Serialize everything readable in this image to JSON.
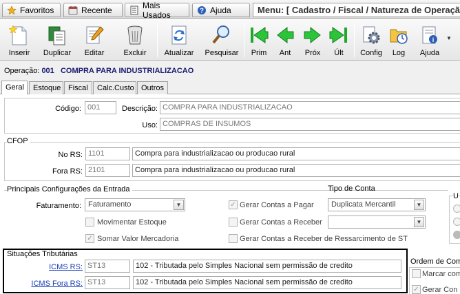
{
  "topbar": {
    "tabs": [
      {
        "label": "Favoritos",
        "icon": "star-icon"
      },
      {
        "label": "Recente",
        "icon": "clock-icon"
      },
      {
        "label": "Mais Usados",
        "icon": "document-icon"
      },
      {
        "label": "Ajuda",
        "icon": "help-icon"
      }
    ],
    "menu_title": "Menu: [ Cadastro / Fiscal / Natureza de Operação ]"
  },
  "toolbar": {
    "inserir": "Inserir",
    "duplicar": "Duplicar",
    "editar": "Editar",
    "excluir": "Excluir",
    "atualizar": "Atualizar",
    "pesquisar": "Pesquisar",
    "prim": "Prim",
    "ant": "Ant",
    "prox": "Próx",
    "ult": "Últ",
    "config": "Config",
    "log": "Log",
    "ajuda": "Ajuda"
  },
  "operation": {
    "label": "Operação:",
    "number": "001",
    "name": "COMPRA PARA INDUSTRIALIZACAO"
  },
  "tabs": [
    "Geral",
    "Estoque",
    "Fiscal",
    "Calc.Custo",
    "Outros"
  ],
  "form": {
    "codigo_label": "Código:",
    "codigo": "001",
    "descricao_label": "Descrição:",
    "descricao": "COMPRA PARA INDUSTRIALIZACAO",
    "uso_label": "Uso:",
    "uso": "COMPRAS DE INSUMOS"
  },
  "cfop": {
    "title": "CFOP",
    "no_rs_label": "No RS:",
    "no_rs_code": "1101",
    "no_rs_desc": "Compra para industrializacao ou producao rural",
    "fora_rs_label": "Fora RS:",
    "fora_rs_code": "2101",
    "fora_rs_desc": "Compra para industrializacao ou producao rural"
  },
  "config": {
    "title": "Principais Configurações da Entrada",
    "faturamento_label": "Faturamento:",
    "faturamento_value": "Faturamento",
    "movimentar_estoque": "Movimentar Estoque",
    "somar_valor": "Somar Valor Mercadoria",
    "gerar_pagar": "Gerar Contas a Pagar",
    "gerar_receber": "Gerar Contas a Receber",
    "gerar_receber_st": "Gerar Contas a Receber de Ressarcimento de ST",
    "tipo_conta_label": "Tipo de Conta",
    "tipo_conta_value": "Duplicata Mercantil",
    "tipo_conta_2": "",
    "checked_mark": "✓"
  },
  "situacoes": {
    "title": "Situações Tributárias",
    "icms_rs_label": "ICMS RS:",
    "icms_rs_code": "ST13",
    "icms_rs_desc": "102 - Tributada pelo Simples Nacional sem permissão de credito",
    "icms_fora_label": "ICMS Fora RS:",
    "icms_fora_code": "ST13",
    "icms_fora_desc": "102 - Tributada pelo Simples Nacional sem permissão de credito"
  },
  "right": {
    "ordem_label": "Ordem de Com",
    "marcar": "Marcar com",
    "gerar": "Gerar Con",
    "u_label": "U"
  }
}
